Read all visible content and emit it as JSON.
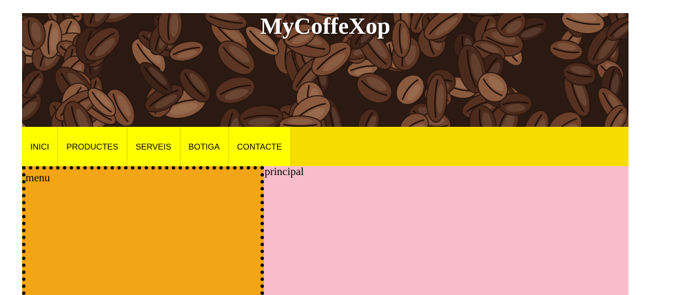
{
  "header": {
    "title": "MyCoffeXop",
    "banner_image": "coffee-beans-photo"
  },
  "nav": {
    "items": [
      {
        "label": "INICI"
      },
      {
        "label": "PRODUCTES"
      },
      {
        "label": "SERVEIS"
      },
      {
        "label": "BOTIGA"
      },
      {
        "label": "CONTACTE"
      }
    ]
  },
  "sections": {
    "menu_label": "menu",
    "main_label": "principal"
  },
  "colors": {
    "nav_bar": "#f7dc00",
    "nav_item": "#ffff00",
    "menu_bg": "#f4a516",
    "main_bg": "#f8bccb",
    "title_text": "#ffffff"
  }
}
